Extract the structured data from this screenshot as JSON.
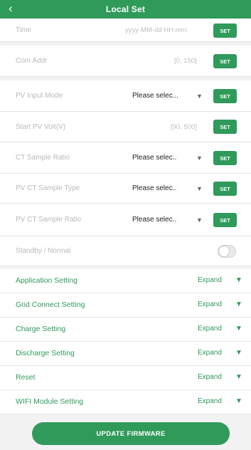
{
  "header": {
    "back_icon": "chevron-left-icon",
    "back_glyph": "‹",
    "title": "Local Set"
  },
  "settings": {
    "set_label": "SET",
    "time": {
      "label": "Time",
      "hint": "yyyy-MM-dd  HH:mm"
    },
    "com_addr": {
      "label": "Com Addr",
      "hint": "[0, 150]"
    },
    "pv_input_mode": {
      "label": "PV Input Mode",
      "value": "Please selec..."
    },
    "start_pv_volt": {
      "label": "Start PV Volt(V)",
      "hint": "[90, 500]"
    },
    "ct_sample_ratio": {
      "label": "CT Sample Ratio",
      "value": "Please selec.."
    },
    "pv_ct_sample_type": {
      "label": "PV CT Sample Type",
      "value": "Please selec.."
    },
    "pv_ct_sample_ratio": {
      "label": "PV CT Sample Ratio",
      "value": "Please selec.."
    },
    "standby_normal": {
      "label": "Standby / Normal",
      "on": false
    },
    "dropdown_glyph": "▼"
  },
  "sections": {
    "expand_label": "Expand",
    "arrow_glyph": "▼",
    "items": [
      {
        "label": "Application Setting"
      },
      {
        "label": "Grid Connect Setting"
      },
      {
        "label": "Charge Setting"
      },
      {
        "label": "Discharge Setting"
      },
      {
        "label": "Reset"
      },
      {
        "label": "WIFI Module Setting"
      }
    ]
  },
  "footer": {
    "update_label": "UPDATE FIRMWARE"
  },
  "colors": {
    "accent": "#2f9a5a",
    "muted_text": "#b8b8b8",
    "background": "#f2f2f2"
  }
}
